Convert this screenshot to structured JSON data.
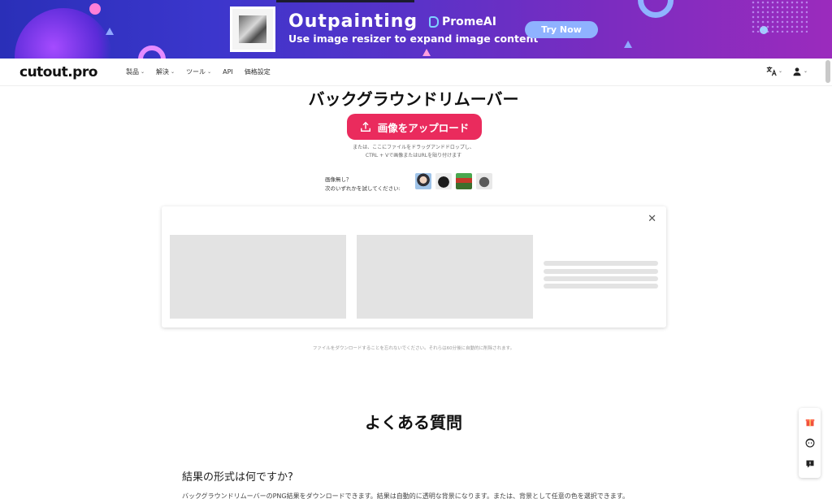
{
  "banner": {
    "title": "Outpainting",
    "subtitle": "Use image resizer to expand image content",
    "brand": "PromeAI",
    "cta": "Try Now"
  },
  "header": {
    "logo": "cutout.pro",
    "nav": [
      {
        "label": "製品",
        "chevron": "⌄"
      },
      {
        "label": "解決",
        "chevron": "⌄"
      },
      {
        "label": "ツール",
        "chevron": "⌄"
      },
      {
        "label": "API",
        "chevron": ""
      },
      {
        "label": "価格設定",
        "chevron": ""
      }
    ],
    "language_icon": "translate-icon",
    "user_icon": "user-icon"
  },
  "main": {
    "title": "バックグラウンドリムーバー",
    "upload_button": "画像をアップロード",
    "hint_line1": "または、ここにファイルをドラッグアンドドロップし、",
    "hint_line2": "CTRL + Vで画像またはURLを貼り付けます",
    "try_line1": "画像無し？",
    "try_line2": "次のいずれかを試してください:",
    "notice": "ファイルをダウンロードすることを忘れないでください。それらは60分後に自動的に削除されます。"
  },
  "faq": {
    "title": "よくある質問",
    "question1": "結果の形式は何ですか?",
    "answer1": "バックグラウンドリムーバーのPNG結果をダウンロードできます。結果は自動的に透明な背景になります。または、背景として任意の色を選択できます。"
  },
  "side_tools": [
    "gift-icon",
    "support-icon",
    "feedback-icon"
  ],
  "colors": {
    "accent": "#ea2b5d",
    "banner_start": "#2a2fb8",
    "banner_end": "#9b2bbd",
    "cta": "#8fb2ff",
    "placeholder": "#e3e3e3"
  }
}
